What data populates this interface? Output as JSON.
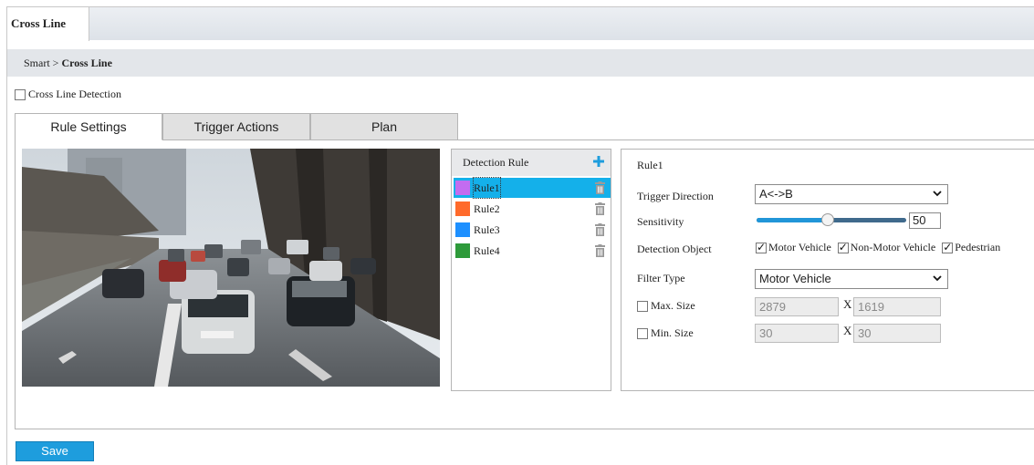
{
  "window": {
    "tab": "Cross Line"
  },
  "breadcrumb": {
    "parent": "Smart",
    "separator": ">",
    "current": "Cross Line"
  },
  "enable": {
    "label": "Cross Line Detection",
    "checked": false
  },
  "tabs": [
    {
      "label": "Rule Settings",
      "active": true
    },
    {
      "label": "Trigger Actions",
      "active": false
    },
    {
      "label": "Plan",
      "active": false
    }
  ],
  "rules": {
    "header": "Detection Rule",
    "items": [
      {
        "name": "Rule1",
        "color": "#c36cf0",
        "selected": true
      },
      {
        "name": "Rule2",
        "color": "#ff6a2b",
        "selected": false
      },
      {
        "name": "Rule3",
        "color": "#1e90ff",
        "selected": false
      },
      {
        "name": "Rule4",
        "color": "#2e9a3a",
        "selected": false
      }
    ]
  },
  "detail": {
    "title": "Rule1",
    "trigger_direction": {
      "label": "Trigger Direction",
      "value": "A<->B"
    },
    "sensitivity": {
      "label": "Sensitivity",
      "value": "50"
    },
    "detection_object": {
      "label": "Detection Object",
      "options": [
        {
          "label": "Motor Vehicle",
          "checked": true
        },
        {
          "label": "Non-Motor Vehicle",
          "checked": true
        },
        {
          "label": "Pedestrian",
          "checked": true
        }
      ]
    },
    "filter_type": {
      "label": "Filter Type",
      "value": "Motor Vehicle"
    },
    "max_size": {
      "label": "Max. Size",
      "checked": false,
      "width": "2879",
      "height": "1619",
      "x": "X"
    },
    "min_size": {
      "label": "Min. Size",
      "checked": false,
      "width": "30",
      "height": "30",
      "x": "X"
    }
  },
  "actions": {
    "save": "Save"
  },
  "colors": {
    "accent": "#1e9ddd",
    "selected_row": "#14b0ea"
  }
}
